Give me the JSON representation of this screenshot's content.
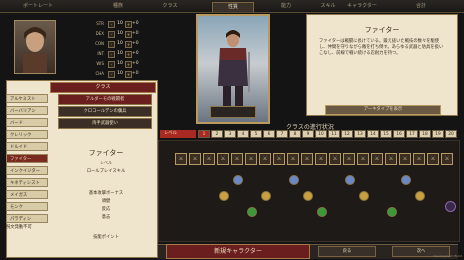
{
  "topbar": {
    "tabs": [
      {
        "label": "ポートレート"
      },
      {
        "label": "種族"
      },
      {
        "label": "クラス"
      },
      {
        "label": "性質"
      },
      {
        "label": "能力"
      },
      {
        "label": "スキル"
      },
      {
        "label": "キャラクター"
      },
      {
        "label": "合計"
      }
    ],
    "active_tab": "性質"
  },
  "attributes": [
    {
      "label": "STR",
      "value": "10",
      "mod": "+0"
    },
    {
      "label": "DEX",
      "value": "10",
      "mod": "+0"
    },
    {
      "label": "CON",
      "value": "10",
      "mod": "+0"
    },
    {
      "label": "INT",
      "value": "10",
      "mod": "+0"
    },
    {
      "label": "WIS",
      "value": "10",
      "mod": "+0"
    },
    {
      "label": "CHA",
      "value": "10",
      "mod": "+0"
    }
  ],
  "description": {
    "title": "ファイター",
    "body": "ファイターは戦闘に長けている。鍛え抜いた戦技の数々を駆使し、仲間を守りながら敵を打ち倒す。あらゆる武器と防具を扱いこなし、前線で戦い続ける忍耐力を持つ。",
    "show_button": "アーキタイプを表示"
  },
  "class_panel": {
    "header": "クラス",
    "classes": [
      "アルケミスト",
      "バーバリアン",
      "バード",
      "クレリック",
      "ドルイド",
      "ファイター",
      "インクイジター",
      "キネティシスト",
      "メイガス",
      "モンク",
      "パラディン"
    ],
    "selected_class": "ファイター",
    "subclasses": [
      "アルダーモの戦闘者",
      "クロコールデンの傭兵",
      "両手武器使い"
    ],
    "info_title": "ファイター",
    "info_lines": [
      "レベル",
      "ロールプレイスキル",
      "基本攻撃ボーナス",
      "頑健",
      "反応",
      "意志",
      "呪文発動不可",
      "技能ポイント"
    ]
  },
  "progression": {
    "title": "クラスの進行状況",
    "level_label": "レベル",
    "levels": [
      "1",
      "2",
      "3",
      "4",
      "5",
      "6",
      "7",
      "8",
      "9",
      "10",
      "11",
      "12",
      "13",
      "14",
      "15",
      "16",
      "17",
      "18",
      "19",
      "20"
    ]
  },
  "bottom": {
    "new_character": "新規キャラクター",
    "back": "戻る",
    "next": "次へ",
    "watermark": "Development Build"
  },
  "colors": {
    "accent": "#6a1e1e",
    "parchment": "#efe5cc",
    "gold": "#b89a60"
  }
}
